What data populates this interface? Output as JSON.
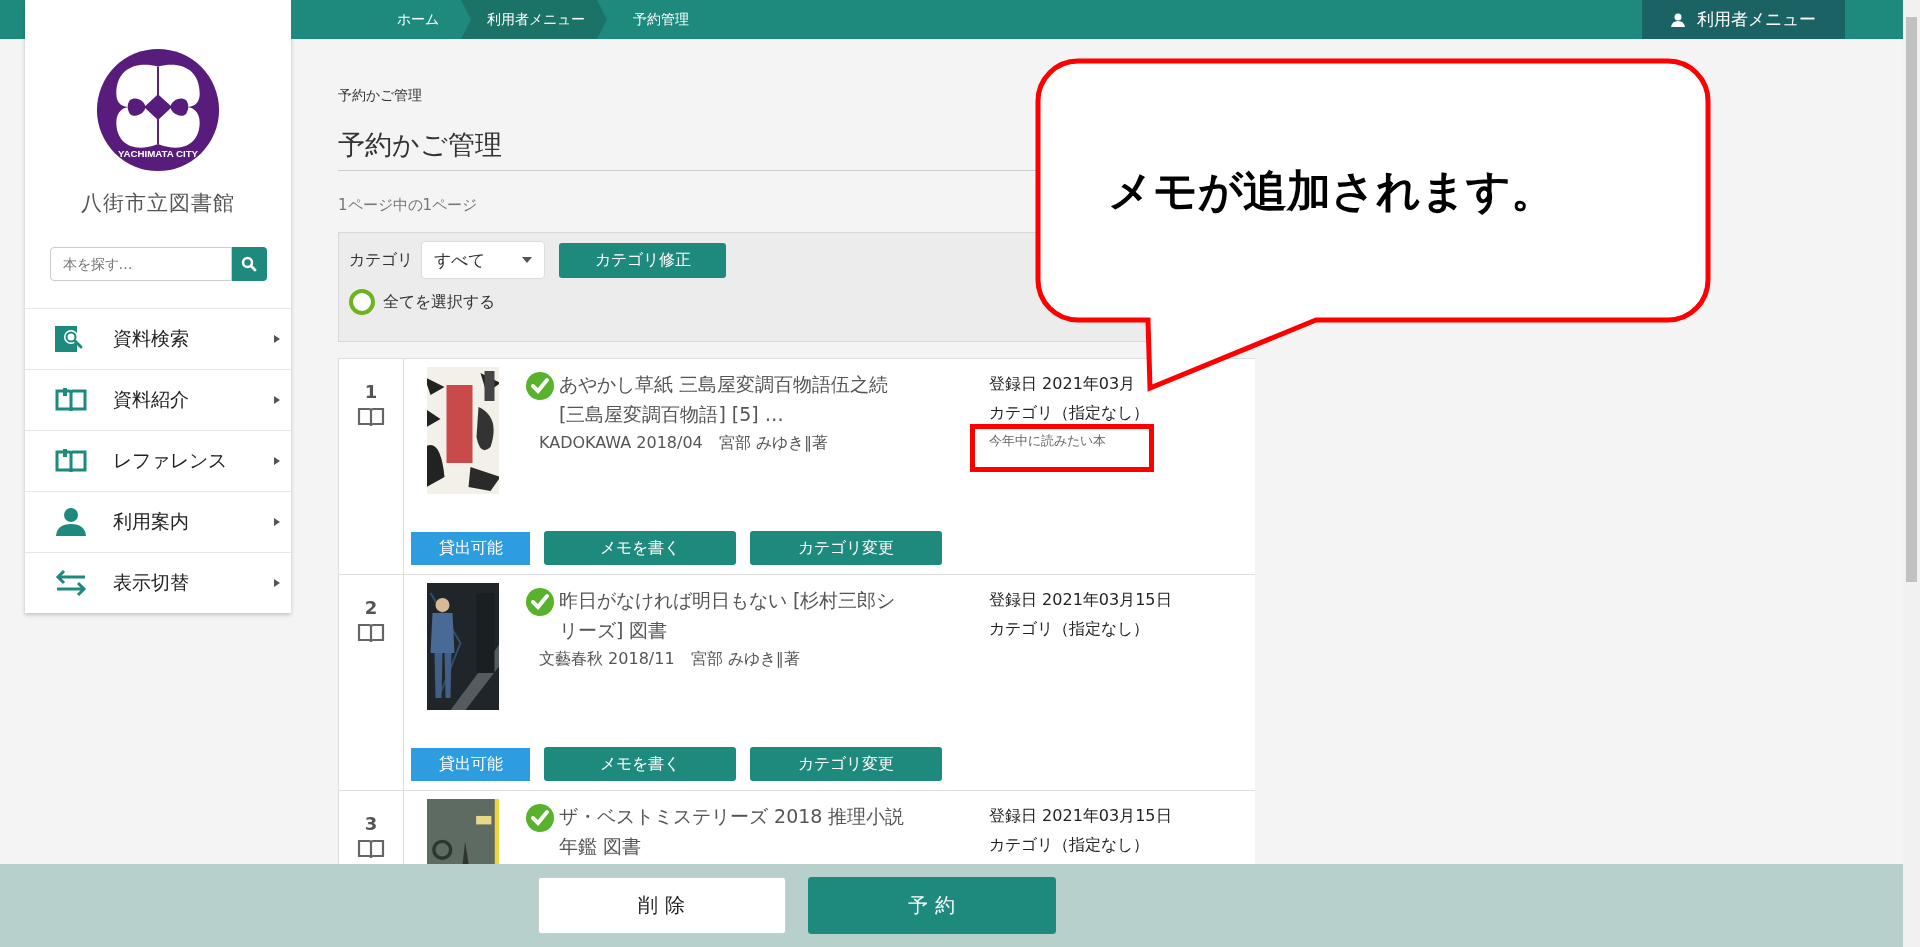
{
  "top_bar": {
    "breadcrumbs": [
      {
        "label": "ホーム",
        "highlighted": false
      },
      {
        "label": "利用者メニュー",
        "highlighted": true
      },
      {
        "label": "予約管理",
        "highlighted": false
      }
    ],
    "user_menu": "利用者メニュー"
  },
  "sidebar": {
    "logo_text": "YACHIMATA CITY",
    "library_name": "八街市立図書館",
    "search": {
      "placeholder": "本を探す…"
    },
    "menu": [
      {
        "label": "資料検索",
        "kind": "search"
      },
      {
        "label": "資料紹介",
        "kind": "book"
      },
      {
        "label": "レファレンス",
        "kind": "book"
      },
      {
        "label": "利用案内",
        "kind": "person"
      },
      {
        "label": "表示切替",
        "kind": "switch"
      }
    ]
  },
  "main": {
    "breadcrumb_title": "予約かご管理",
    "title": "予約かご管理",
    "page_info": "1ページ中の1ページ",
    "filter": {
      "label": "カテゴリ",
      "select": "すべて",
      "button": "カテゴリ修正",
      "select_all": {
        "label": "全てを選択する",
        "checked": false
      }
    },
    "items": [
      {
        "number": "1",
        "title": "あやかし草紙 三島屋変調百物語伍之続 [三島屋変調百物語] [5] …",
        "publisher": "KADOKAWA 2018/04　宮部 みゆき∥著",
        "registered": "登録日 2021年03月",
        "category": "カテゴリ（指定なし）",
        "memo": "今年中に読みたい本",
        "status": "貸出可能",
        "buttons": [
          "メモを書く",
          "カテゴリ変更"
        ]
      },
      {
        "number": "2",
        "title": "昨日がなければ明日もない [杉村三郎シリーズ] 図書",
        "publisher": "文藝春秋 2018/11　宮部 みゆき∥著",
        "registered": "登録日 2021年03月15日",
        "category": "カテゴリ（指定なし）",
        "status": "貸出可能",
        "buttons": [
          "メモを書く",
          "カテゴリ変更"
        ]
      },
      {
        "number": "3",
        "title": "ザ・ベストミステリーズ 2018 推理小説年鑑 図書",
        "registered": "登録日 2021年03月15日",
        "category": "カテゴリ（指定なし）"
      }
    ]
  },
  "footer": {
    "buttons": [
      {
        "label": "削 除",
        "kind": "secondary"
      },
      {
        "label": "予 約",
        "kind": "primary"
      }
    ]
  },
  "annotation": {
    "text": "メモが追加されます。"
  }
}
